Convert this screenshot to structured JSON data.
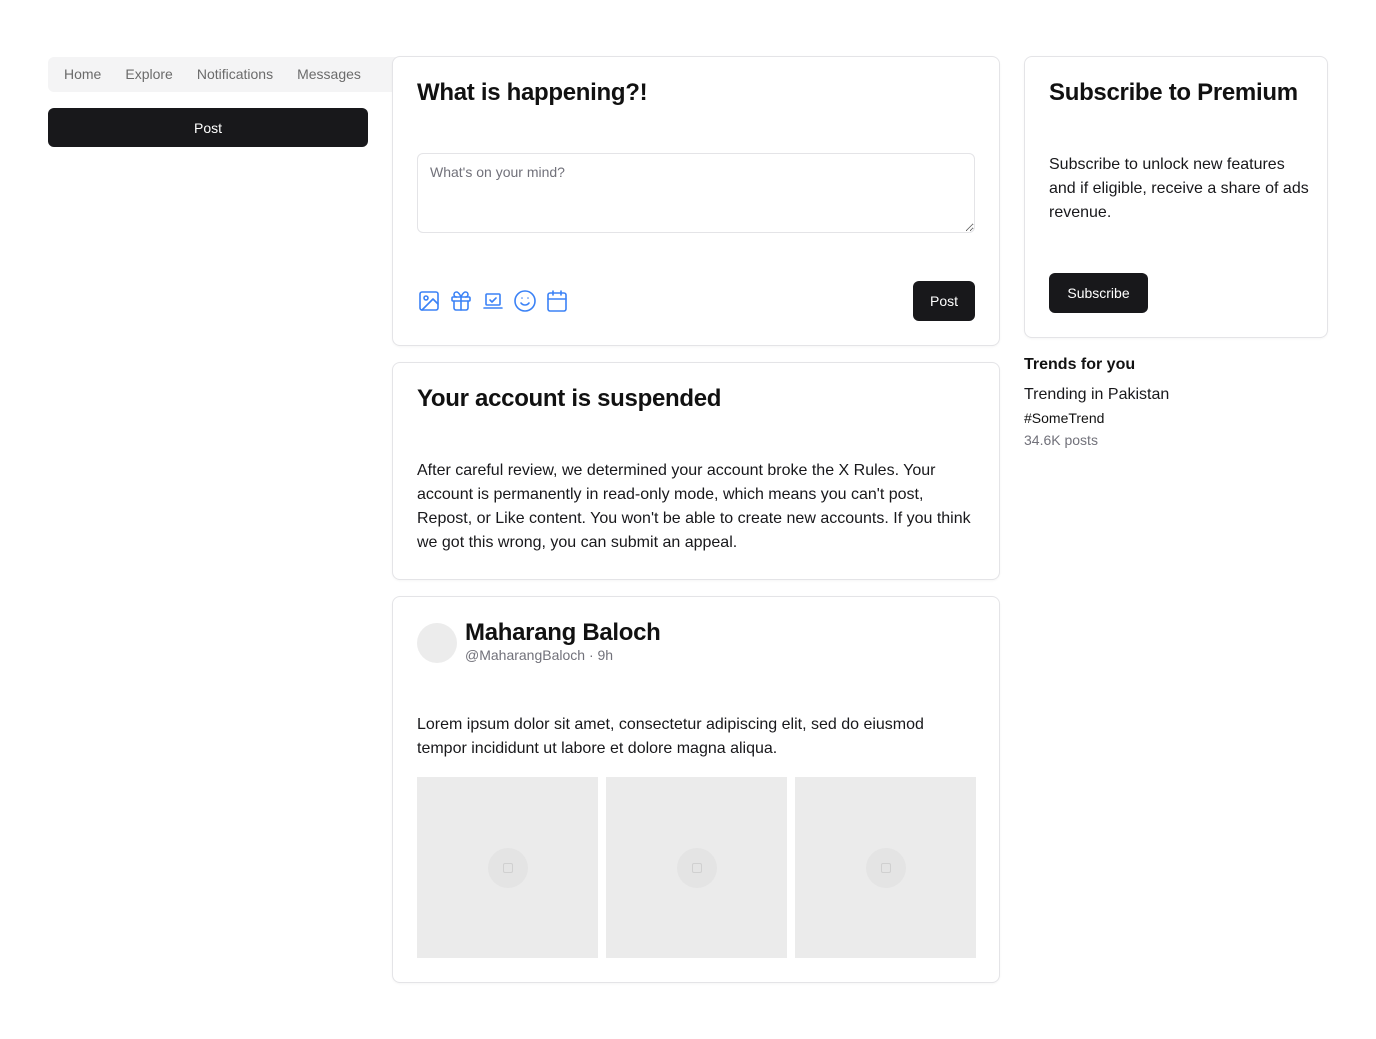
{
  "nav": {
    "items": [
      {
        "label": "Home"
      },
      {
        "label": "Explore"
      },
      {
        "label": "Notifications"
      },
      {
        "label": "Messages"
      }
    ]
  },
  "sidebar": {
    "post_label": "Post"
  },
  "compose": {
    "title": "What is happening?!",
    "placeholder": "What's on your mind?",
    "post_label": "Post",
    "icons": [
      "image-icon",
      "gift-icon",
      "laptop-check-icon",
      "smile-icon",
      "calendar-icon"
    ],
    "icon_color": "#3b82f6"
  },
  "suspension": {
    "title": "Your account is suspended",
    "message": "After careful review, we determined your account broke the X Rules. Your account is permanently in read-only mode, which means you can't post, Repost, or Like content. You won't be able to create new accounts. If you think we got this wrong, you can submit an appeal."
  },
  "tweet": {
    "author_name": "Maharang Baloch",
    "author_meta": "@MaharangBaloch · 9h",
    "text": "Lorem ipsum dolor sit amet, consectetur adipiscing elit, sed do eiusmod tempor incididunt ut labore et dolore magna aliqua.",
    "media_count": 3
  },
  "premium": {
    "title": "Subscribe to Premium",
    "text": "Subscribe to unlock new features and if eligible, receive a share of ads revenue.",
    "button_label": "Subscribe"
  },
  "trends": {
    "title": "Trends for you",
    "location": "Trending in Pakistan",
    "tag": "#SomeTrend",
    "count": "34.6K posts"
  },
  "colors": {
    "primary_button": "#18181b",
    "border": "#e4e4e7",
    "muted_text": "#71717a"
  }
}
